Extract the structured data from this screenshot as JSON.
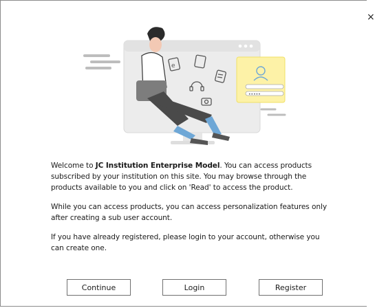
{
  "modal": {
    "close_icon": "close-icon",
    "close_symbol": "×",
    "welcome": {
      "prefix": "Welcome to ",
      "brand": "JC Institution Enterprise Model",
      "suffix": ". You can access products subscribed by your institution on this site. You may browse through the products available to you and click on 'Read' to access the product."
    },
    "para2": "While you can access products, you can access personalization features only after creating a sub user account.",
    "para3": "If you have already registered, please login to your account, otherwise you can create one.",
    "buttons": {
      "continue": "Continue",
      "login": "Login",
      "register": "Register"
    },
    "illustration": {
      "login_card_password": "•••••",
      "colors": {
        "card": "#fdf2a7",
        "card_border": "#f0e066",
        "accent_blue": "#6ea7d6",
        "monitor": "#ebebeb"
      }
    }
  }
}
